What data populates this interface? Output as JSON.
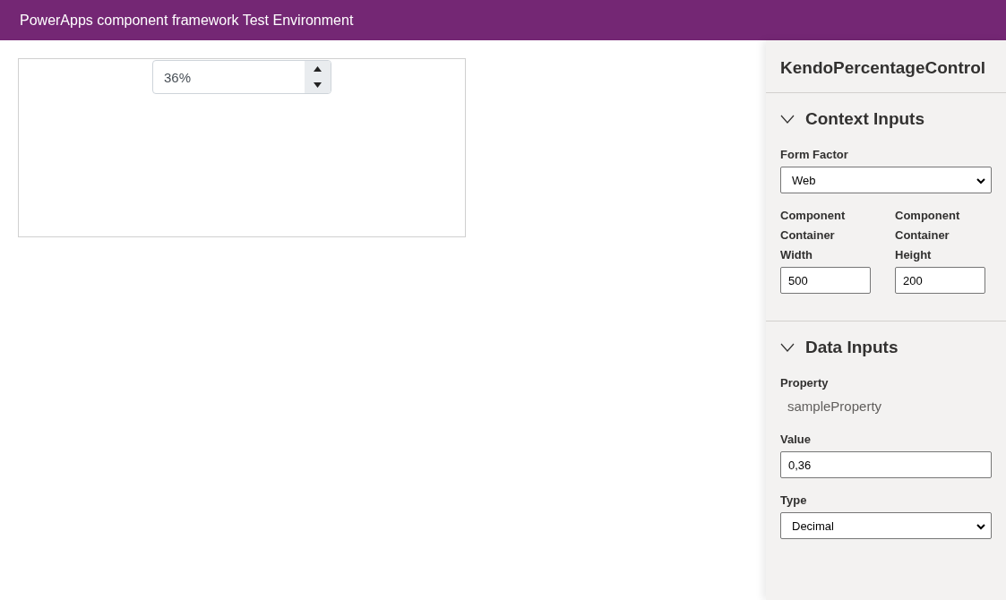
{
  "header": {
    "title": "PowerApps component framework Test Environment"
  },
  "stage": {
    "numeric_input": {
      "value": "36%"
    }
  },
  "panel": {
    "title": "KendoPercentageControl",
    "sections": [
      {
        "title": "Context Inputs",
        "expanded": true,
        "fields": [
          {
            "kind": "select",
            "label": "Form Factor",
            "value": "Web"
          },
          {
            "kind": "pair",
            "items": [
              {
                "label": "Component Container Width",
                "value": "500"
              },
              {
                "label": "Component Container Height",
                "value": "200"
              }
            ]
          }
        ]
      },
      {
        "title": "Data Inputs",
        "expanded": true,
        "fields": [
          {
            "kind": "readonly",
            "label": "Property",
            "value": "sampleProperty"
          },
          {
            "kind": "text",
            "label": "Value",
            "value": "0,36"
          },
          {
            "kind": "select",
            "label": "Type",
            "value": "Decimal"
          }
        ]
      }
    ]
  }
}
